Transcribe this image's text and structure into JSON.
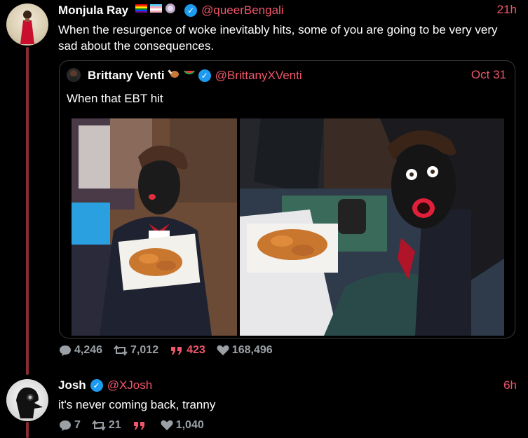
{
  "post1": {
    "name": "Monjula Ray",
    "handle": "@queerBengali",
    "time": "21h",
    "text": "When the resurgence of woke inevitably hits, some of you are going to be very very sad about the consequences.",
    "stats": {
      "replies": "4,246",
      "reposts": "7,012",
      "quotes": "423",
      "likes": "168,496"
    }
  },
  "quote": {
    "name": "Brittany Venti",
    "handle": "@BrittanyXVenti",
    "time": "Oct 31",
    "text": "When that EBT hit"
  },
  "post2": {
    "name": "Josh",
    "handle": "@XJosh",
    "time": "6h",
    "text": "it's never coming back, tranny",
    "stats": {
      "replies": "7",
      "reposts": "21",
      "likes": "1,040"
    }
  },
  "icons": [
    "reply-icon",
    "repost-icon",
    "quote-icon",
    "like-icon",
    "verified-icon"
  ],
  "colors": {
    "accent": "#f0566a",
    "thread": "#8b2b33",
    "verified": "#1d9bf0",
    "muted": "#9aa0a6"
  }
}
